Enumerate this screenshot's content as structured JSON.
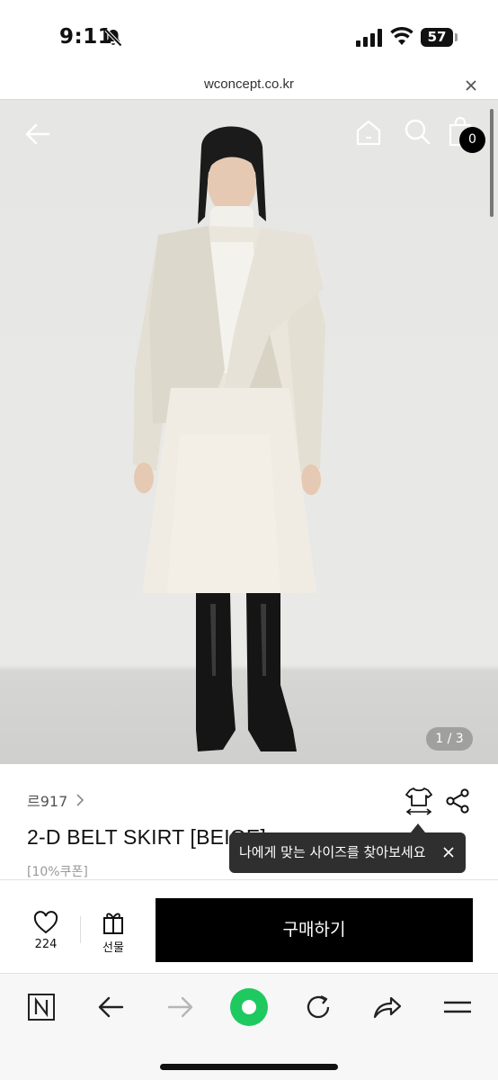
{
  "status_bar": {
    "time": "9:11",
    "battery": "57"
  },
  "url_bar": {
    "url": "wconcept.co.kr"
  },
  "header": {
    "cart_count": "0"
  },
  "gallery": {
    "pager": "1 / 3"
  },
  "product": {
    "brand": "르917",
    "title": "2-D BELT SKIRT [BEIGE]",
    "coupon": "[10%쿠폰]"
  },
  "tooltip": {
    "text": "나에게 맞는 사이즈를 찾아보세요"
  },
  "purchase_bar": {
    "like_count": "224",
    "gift_label": "선물",
    "buy_label": "구매하기"
  },
  "icons": {
    "back": "arrow-left-icon",
    "home": "home-icon",
    "search": "search-icon",
    "cart": "shopping-bag-icon",
    "size": "size-guide-icon",
    "share": "share-icon",
    "like": "heart-icon",
    "gift": "gift-icon"
  },
  "colors": {
    "buy_button": "#000000",
    "browser_accent": "#1ec95f",
    "tooltip": "#2f2f2f"
  }
}
